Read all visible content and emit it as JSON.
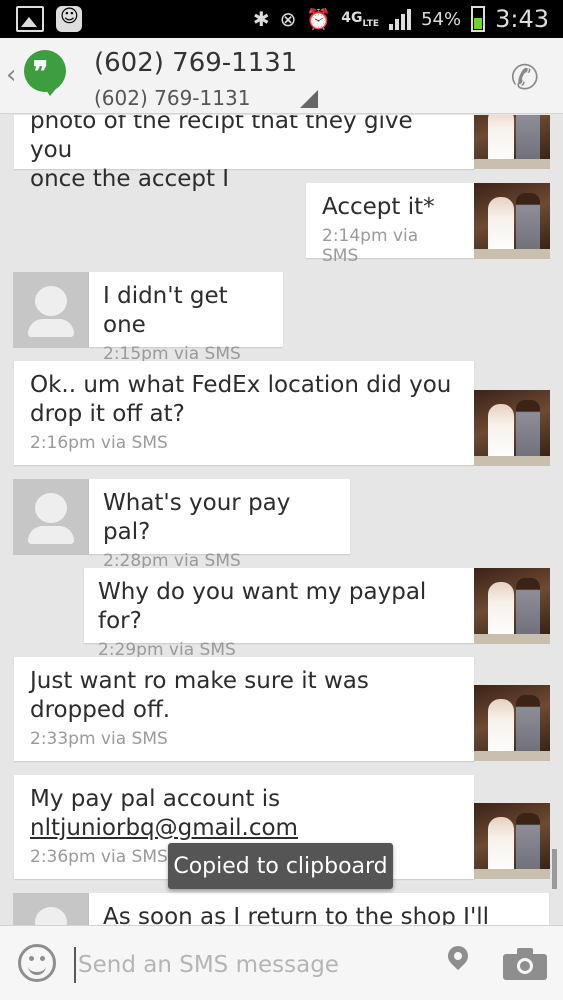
{
  "status_bar": {
    "battery_percent": "54%",
    "time": "3:43",
    "network": "4G",
    "network_sub": "LTE",
    "battery_color": "#6bd630",
    "icons": [
      "gallery-icon",
      "chat-icon",
      "bluetooth-icon",
      "mute-icon",
      "alarm-icon",
      "signal-icon",
      "battery-icon"
    ]
  },
  "header": {
    "title": "(602) 769-1131",
    "subtitle": "(602) 769-1131",
    "app_icon": "hangouts-icon",
    "accent_color": "#3c9e3f"
  },
  "messages": [
    {
      "side": "incoming-photo",
      "text": "photo of the recipt that they give you\nonce the accept I",
      "meta": ""
    },
    {
      "side": "outgoing",
      "text": "Accept it*",
      "meta": "2:14pm via SMS"
    },
    {
      "side": "incoming",
      "text": "I didn't get one",
      "meta": "2:15pm via SMS"
    },
    {
      "side": "outgoing-left",
      "text": "Ok.. um what FedEx location  did you\ndrop it off at?",
      "meta": "2:16pm via SMS"
    },
    {
      "side": "incoming",
      "text": "What's your pay pal?",
      "meta": "2:28pm via SMS"
    },
    {
      "side": "outgoing",
      "text": "Why do you want my paypal for?",
      "meta": "2:29pm via SMS"
    },
    {
      "side": "outgoing-left",
      "text": "Just want ro make sure it was\ndropped off.",
      "meta": "2:33pm via SMS"
    },
    {
      "side": "outgoing-left",
      "text": "My pay pal account is",
      "link": "nltjuniorbq@gmail.com",
      "meta": "2:36pm via SMS"
    },
    {
      "side": "incoming",
      "text": "As soon as I return to the shop I'll",
      "meta": ""
    }
  ],
  "toast": "Copied to clipboard",
  "composer": {
    "placeholder": "Send an SMS message"
  }
}
